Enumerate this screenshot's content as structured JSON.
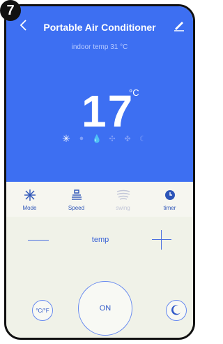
{
  "step_badge": "7",
  "header": {
    "title": "Portable Air Conditioner",
    "subtitle": "indoor temp 31 °C",
    "set_temperature": "17",
    "unit": "°C"
  },
  "mode_icons": [
    "cool-icon",
    "fan-dot-icon",
    "dry-icon",
    "fan-icon",
    "heat-icon",
    "sleep-icon"
  ],
  "tabs": [
    {
      "label": "Mode",
      "icon": "cool-icon"
    },
    {
      "label": "Speed",
      "icon": "speed-icon"
    },
    {
      "label": "swing",
      "icon": "swing-icon",
      "disabled": true
    },
    {
      "label": "timer",
      "icon": "clock-icon"
    }
  ],
  "control": {
    "temp_label": "temp",
    "power_label": "ON",
    "unit_toggle_label": "°C/°F"
  },
  "colors": {
    "header_bg": "#3d6ff2",
    "accent": "#3a63d6"
  }
}
